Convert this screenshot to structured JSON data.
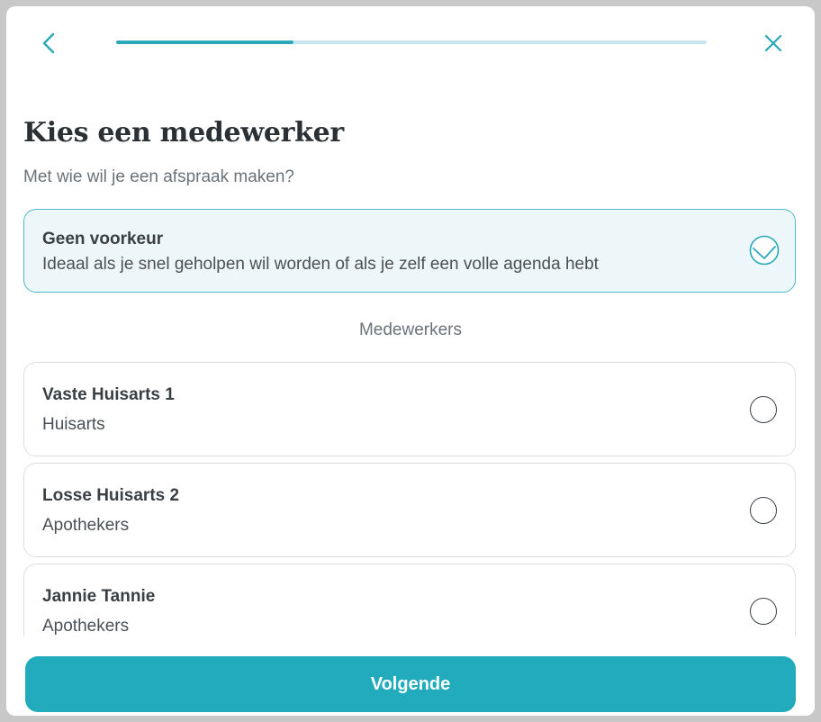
{
  "header": {
    "back_icon": "chevron-left-icon",
    "close_icon": "close-icon",
    "progress_fraction": 0.3,
    "accent_color": "#2aa8b8"
  },
  "title": "Kies een medewerker",
  "subtitle": "Met wie wil je een afspraak maken?",
  "no_preference": {
    "title": "Geen voorkeur",
    "description": "Ideaal als je snel geholpen wil worden of als je zelf een volle agenda hebt",
    "selected": true
  },
  "section_label": "Medewerkers",
  "employees": [
    {
      "name": "Vaste Huisarts 1",
      "role": "Huisarts",
      "selected": false
    },
    {
      "name": "Losse Huisarts 2",
      "role": "Apothekers",
      "selected": false
    },
    {
      "name": "Jannie Tannie",
      "role": "Apothekers",
      "selected": false
    }
  ],
  "footer": {
    "next_label": "Volgende",
    "button_color": "#21abbd"
  }
}
